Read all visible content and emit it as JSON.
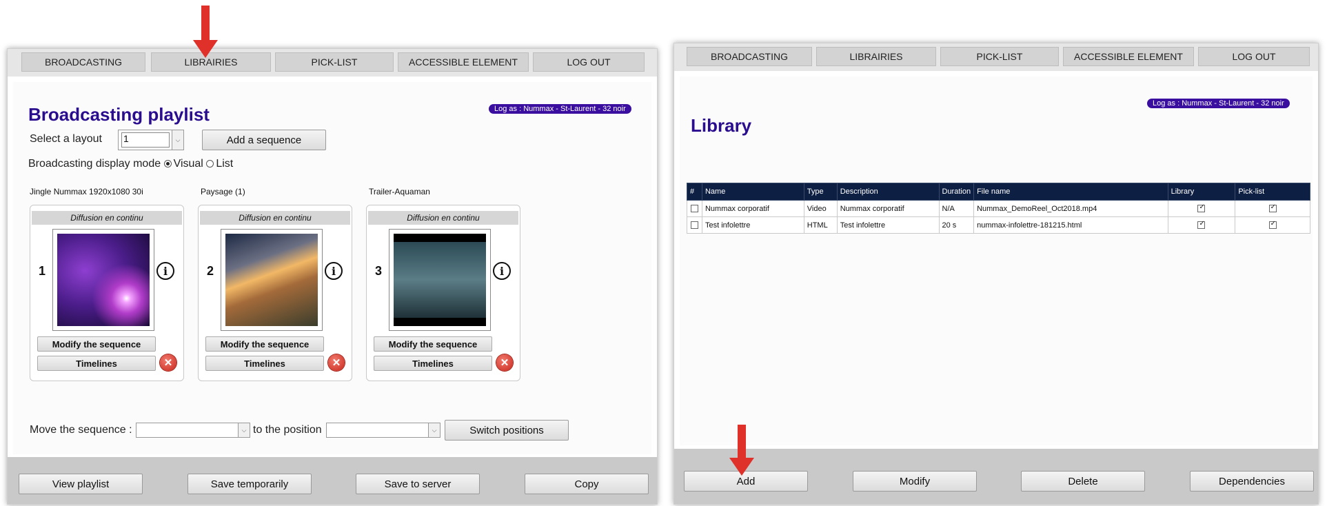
{
  "left": {
    "nav": [
      "BROADCASTING",
      "LIBRAIRIES",
      "PICK-LIST",
      "ACCESSIBLE ELEMENT",
      "LOG OUT"
    ],
    "title": "Broadcasting playlist",
    "log_as": "Log as : Nummax - St-Laurent - 32 noir",
    "select_layout_label": "Select a layout",
    "layout_value": "1",
    "add_sequence": "Add a sequence",
    "display_mode_label": "Broadcasting display mode",
    "mode_visual": "Visual",
    "mode_list": "List",
    "mode_selected": "Visual",
    "sequences": [
      {
        "title": "Jingle Nummax 1920x1080 30i",
        "header": "Diffusion en continu",
        "number": "1",
        "modify": "Modify the sequence",
        "timelines": "Timelines",
        "thumb": "purple-galaxy"
      },
      {
        "title": "Paysage (1)",
        "header": "Diffusion en continu",
        "number": "2",
        "modify": "Modify the sequence",
        "timelines": "Timelines",
        "thumb": "mountain-sunset"
      },
      {
        "title": "Trailer-Aquaman",
        "header": "Diffusion en continu",
        "number": "3",
        "modify": "Modify the sequence",
        "timelines": "Timelines",
        "thumb": "movie-still"
      }
    ],
    "move_label": "Move the sequence :",
    "to_position_label": "to the position",
    "switch_positions": "Switch positions",
    "footer": [
      "View playlist",
      "Save temporarily",
      "Save to server",
      "Copy"
    ]
  },
  "right": {
    "nav": [
      "BROADCASTING",
      "LIBRAIRIES",
      "PICK-LIST",
      "ACCESSIBLE ELEMENT",
      "LOG OUT"
    ],
    "title": "Library",
    "log_as": "Log as : Nummax - St-Laurent - 32 noir",
    "columns": [
      "#",
      "Name",
      "Type",
      "Description",
      "Duration",
      "File name",
      "Library",
      "Pick-list"
    ],
    "rows": [
      {
        "name": "Nummax corporatif",
        "type": "Video",
        "description": "Nummax corporatif",
        "duration": "N/A",
        "file": "Nummax_DemoReel_Oct2018.mp4",
        "library": true,
        "picklist": true
      },
      {
        "name": "Test infolettre",
        "type": "HTML",
        "description": "Test infolettre",
        "duration": "20 s",
        "file": "nummax-infolettre-181215.html",
        "library": true,
        "picklist": true
      }
    ],
    "footer": [
      "Add",
      "Modify",
      "Delete",
      "Dependencies"
    ]
  },
  "colors": {
    "accent": "#2a0c8f",
    "badge": "#3a0fa0",
    "arrow": "#e0302a",
    "table_header": "#0e1f44"
  }
}
